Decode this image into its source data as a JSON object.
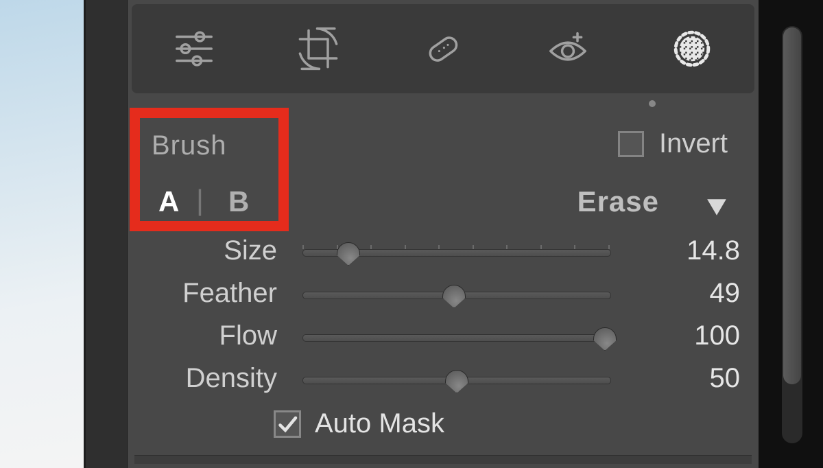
{
  "toolbar": {
    "tools": [
      {
        "name": "edit-sliders-icon",
        "active": false
      },
      {
        "name": "crop-icon",
        "active": false
      },
      {
        "name": "healing-icon",
        "active": false
      },
      {
        "name": "redeye-icon",
        "active": false
      },
      {
        "name": "masking-icon",
        "active": true
      }
    ]
  },
  "brush_panel": {
    "title": "Brush",
    "invert": {
      "label": "Invert",
      "checked": false
    },
    "tabs": {
      "a": "A",
      "b": "B",
      "active": "A",
      "erase_label": "Erase"
    },
    "sliders": {
      "size": {
        "label": "Size",
        "value": 14.8,
        "display": "14.8",
        "min": 0,
        "max": 100
      },
      "feather": {
        "label": "Feather",
        "value": 49,
        "display": "49",
        "min": 0,
        "max": 100
      },
      "flow": {
        "label": "Flow",
        "value": 100,
        "display": "100",
        "min": 0,
        "max": 100
      },
      "density": {
        "label": "Density",
        "value": 50,
        "display": "50",
        "min": 0,
        "max": 100
      }
    },
    "automask": {
      "label": "Auto Mask",
      "checked": true
    }
  },
  "highlight_color": "#E52C1C"
}
